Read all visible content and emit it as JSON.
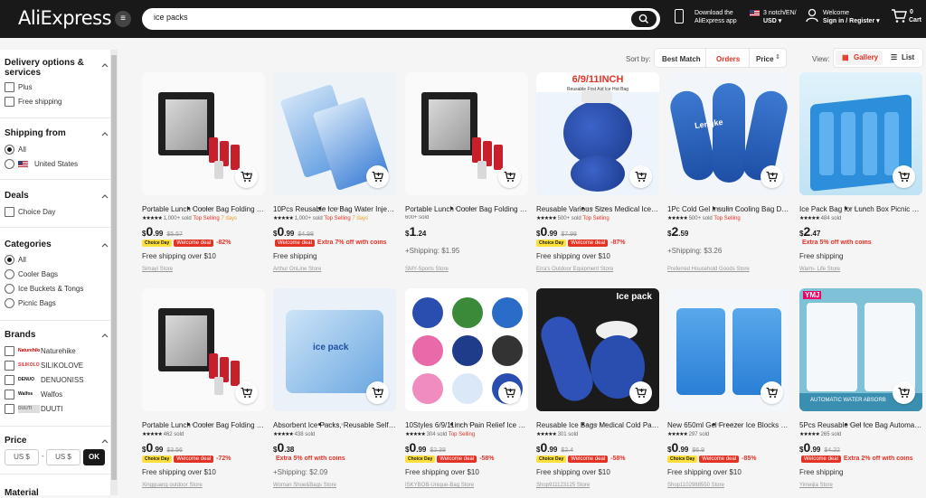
{
  "header": {
    "logo": "AliExpress",
    "search_value": "ice packs",
    "app_line1": "Download the",
    "app_line2": "AliExpress app",
    "lang_line1": "3 notch/EN/",
    "lang_line2": "USD ▾",
    "user_line1": "Welcome",
    "user_line2": "Sign in / Register ▾",
    "cart_count": "0",
    "cart_label": "Cart"
  },
  "sidebar": {
    "delivery": {
      "title_1": "Delivery options &",
      "title_2": "services",
      "options": [
        "Plus",
        "Free shipping"
      ]
    },
    "shipping_from": {
      "title": "Shipping from",
      "options": [
        "All",
        "United States"
      ]
    },
    "deals": {
      "title": "Deals",
      "options": [
        "Choice Day"
      ]
    },
    "categories": {
      "title": "Categories",
      "options": [
        "All",
        "Cooler Bags",
        "Ice Buckets & Tongs",
        "Picnic Bags"
      ]
    },
    "brands": {
      "title": "Brands",
      "options": [
        "Naturehike",
        "SILIKOLOVE",
        "DENUONISS",
        "Walfos",
        "DUUTI"
      ],
      "logos": [
        "Naturehike",
        "SILIKOLOVE",
        "DENUO",
        "Walfos",
        "DUUTI"
      ]
    },
    "price": {
      "title": "Price",
      "min": "US $",
      "max": "US $",
      "dash": "-",
      "ok": "OK"
    },
    "material": {
      "title": "Material"
    }
  },
  "sortbar": {
    "label": "Sort by:",
    "options": [
      "Best Match",
      "Orders",
      "Price"
    ],
    "active": "Orders",
    "view_label": "View:",
    "gallery": "Gallery",
    "list": "List"
  },
  "products": [
    {
      "title": "Portable Lunch Cooler Bag Folding Insulation Picnic Ice Pack",
      "stars": "★★★★★",
      "sold": "1,000+ sold",
      "badge": "Top Selling",
      "days": "7 days",
      "price_int": "0",
      "price_dec": ".99",
      "old": "$5.57",
      "choice": true,
      "welcome": "Welcome deal",
      "disc": "-82%",
      "extra": "",
      "ship": "Free shipping over $10",
      "store": "Simayi Store"
    },
    {
      "title": "10Pcs Reusable Ice Bag Water Injection Icing Cooler Bag",
      "stars": "★★★★★",
      "sold": "1,000+ sold",
      "badge": "Top Selling",
      "days": "7 days",
      "price_int": "0",
      "price_dec": ".99",
      "old": "$4.98",
      "choice": false,
      "welcome": "Welcome deal",
      "disc": "",
      "extra": "Extra 7% off with coins",
      "ship": "Free shipping",
      "store": "Arthur OnLine Store"
    },
    {
      "title": "Portable Lunch Cooler Bag Folding Insulation Picnic Ice Pack",
      "stars": "",
      "sold": "600+ sold",
      "badge": "",
      "days": "",
      "price_int": "1",
      "price_dec": ".24",
      "old": "",
      "choice": false,
      "welcome": "",
      "disc": "",
      "extra": "",
      "ship": "+Shipping: $1.95",
      "store": "SMY-Sports Store"
    },
    {
      "title": "Reusable Various Sizes Medical Ice Bag Cold Therapy",
      "stars": "★★★★★",
      "sold": "500+ sold",
      "badge": "Top Selling",
      "days": "",
      "price_int": "0",
      "price_dec": ".99",
      "old": "$7.98",
      "choice": true,
      "welcome": "Welcome deal",
      "disc": "-87%",
      "extra": "",
      "ship": "Free shipping over $10",
      "store": "Erra's Outdoor Equipment Store"
    },
    {
      "title": "1Pc Cold Gel Insulin Cooling Bag Diabetic Pocket",
      "stars": "★★★★★",
      "sold": "500+ sold",
      "badge": "Top Selling",
      "days": "",
      "price_int": "2",
      "price_dec": ".59",
      "old": "",
      "choice": false,
      "welcome": "",
      "disc": "",
      "extra": "",
      "ship": "+Shipping: $3.26",
      "store": "Preferred Household Goods Store"
    },
    {
      "title": "Ice Pack Bag for Lunch Box Picnic Reusable Cooler",
      "stars": "★★★★★",
      "sold": "484 sold",
      "badge": "",
      "days": "",
      "price_int": "2",
      "price_dec": ".47",
      "old": "",
      "choice": false,
      "welcome": "",
      "disc": "",
      "extra": "Extra 5% off with coins",
      "ship": "Free shipping",
      "store": "Warm- Life Store"
    },
    {
      "title": "Portable Lunch Cooler Bag Folding Insulation Picnic Ice Pack",
      "stars": "★★★★★",
      "sold": "462 sold",
      "badge": "",
      "days": "",
      "price_int": "0",
      "price_dec": ".99",
      "old": "$3.56",
      "choice": true,
      "welcome": "Welcome deal",
      "disc": "-72%",
      "extra": "",
      "ship": "Free shipping over $10",
      "store": "Xingguang outdoor Store"
    },
    {
      "title": "Absorbent Ice Packs, Reusable Self-Suction Ice Bag",
      "stars": "★★★★★",
      "sold": "438 sold",
      "badge": "",
      "days": "",
      "price_int": "0",
      "price_dec": ".38",
      "old": "",
      "choice": false,
      "welcome": "",
      "disc": "",
      "extra": "Extra 5% off with coins",
      "ship": "+Shipping: $2.09",
      "store": "Woman Shoe&Bags Store"
    },
    {
      "title": "10Styles 6/9/11inch Pain Relief Ice Bag Reusable",
      "stars": "★★★★★",
      "sold": "304 sold",
      "badge": "Top Selling",
      "days": "",
      "price_int": "0",
      "price_dec": ".99",
      "old": "$2.38",
      "choice": true,
      "welcome": "Welcome deal",
      "disc": "-58%",
      "extra": "",
      "ship": "Free shipping over $10",
      "store": "ISKYBOB-Unique-Bag Store"
    },
    {
      "title": "Reusable Ice Bags Medical Cold Pack Sports Injury",
      "stars": "★★★★★",
      "sold": "301 sold",
      "badge": "",
      "days": "",
      "price_int": "0",
      "price_dec": ".99",
      "old": "$2.4",
      "choice": true,
      "welcome": "Welcome deal",
      "disc": "-58%",
      "extra": "",
      "ship": "Free shipping over $10",
      "store": "Shop911123125 Store"
    },
    {
      "title": "New 650ml Gel Freezer Ice Blocks Reusable Cooler",
      "stars": "★★★★★",
      "sold": "297 sold",
      "badge": "",
      "days": "",
      "price_int": "0",
      "price_dec": ".99",
      "old": "$6.9",
      "choice": true,
      "welcome": "Welcome deal",
      "disc": "-85%",
      "extra": "",
      "ship": "Free shipping over $10",
      "store": "Shop1102988550 Store"
    },
    {
      "title": "5Pcs Reusable Gel Ice Bag Automatic Water Absorbing",
      "stars": "★★★★★",
      "sold": "265 sold",
      "badge": "",
      "days": "",
      "price_int": "0",
      "price_dec": ".99",
      "old": "$4.22",
      "choice": false,
      "welcome": "Welcome deal",
      "disc": "",
      "extra": "Extra 2% off with coins",
      "ship": "Free shipping",
      "store": "Yimeijia Store"
    }
  ],
  "image_text": {
    "p4_banner": "6/9/11INCH",
    "p4_sub": "Reusable First Aid Ice Hot Bag",
    "p5_brand": "Lengke",
    "p8_pack": "ice pack",
    "p10_overlay": "Ice pack",
    "p12_brand": "YMJ",
    "p12_caption": "AUTOMATIC WATER ABSORB"
  },
  "colors": {
    "accent": "#e43225",
    "header_bg": "#191919",
    "choice_yellow": "#ffe03a"
  }
}
